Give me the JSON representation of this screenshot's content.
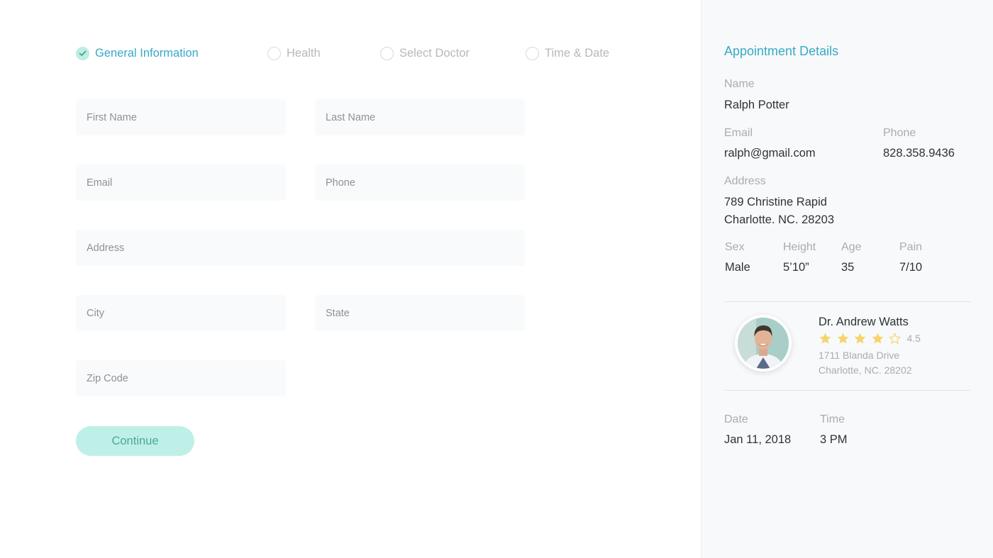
{
  "stepper": {
    "steps": [
      {
        "label": "General Information",
        "status": "completed"
      },
      {
        "label": "Health",
        "status": "pending"
      },
      {
        "label": "Select Doctor",
        "status": "pending"
      },
      {
        "label": "Time & Date",
        "status": "pending"
      }
    ]
  },
  "form": {
    "first_name": {
      "placeholder": "First Name",
      "value": ""
    },
    "last_name": {
      "placeholder": "Last Name",
      "value": ""
    },
    "email": {
      "placeholder": "Email",
      "value": ""
    },
    "phone": {
      "placeholder": "Phone",
      "value": ""
    },
    "address": {
      "placeholder": "Address",
      "value": ""
    },
    "city": {
      "placeholder": "City",
      "value": ""
    },
    "state": {
      "placeholder": "State",
      "value": ""
    },
    "zip": {
      "placeholder": "Zip Code",
      "value": ""
    },
    "continue_label": "Continue"
  },
  "details": {
    "title": "Appointment Details",
    "name_label": "Name",
    "name": "Ralph Potter",
    "email_label": "Email",
    "email": "ralph@gmail.com",
    "phone_label": "Phone",
    "phone": "828.358.9436",
    "address_label": "Address",
    "address_line1": "789 Christine Rapid",
    "address_line2": "Charlotte. NC. 28203",
    "sex_label": "Sex",
    "sex": "Male",
    "height_label": "Height",
    "height": "5’10”",
    "age_label": "Age",
    "age": "35",
    "pain_label": "Pain",
    "pain": "7/10"
  },
  "doctor": {
    "name": "Dr. Andrew Watts",
    "rating": "4.5",
    "stars_filled": 4,
    "stars_total": 5,
    "address_line1": "1711 Blanda Drive",
    "address_line2": "Charlotte, NC. 28202"
  },
  "appointment": {
    "date_label": "Date",
    "date": "Jan 11, 2018",
    "time_label": "Time",
    "time": "3 PM"
  },
  "colors": {
    "accent": "#37a9c8",
    "button_bg": "#bff0e7",
    "button_text": "#4aa79a",
    "star": "#f7d36b",
    "panel_bg": "#f8f9fa"
  }
}
